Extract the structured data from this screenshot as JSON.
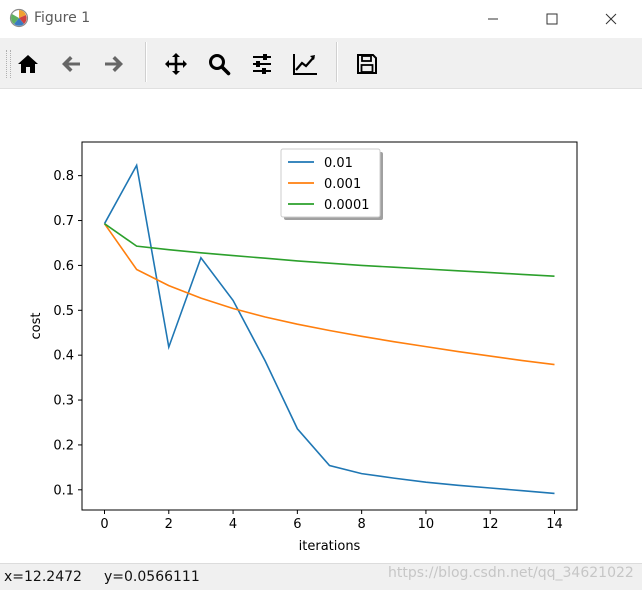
{
  "window": {
    "title": "Figure 1",
    "controls": {
      "minimize": "—",
      "maximize": "☐",
      "close": "✕"
    }
  },
  "toolbar": {
    "buttons": [
      {
        "icon": "home-icon"
      },
      {
        "icon": "back-arrow-icon"
      },
      {
        "icon": "forward-arrow-icon"
      },
      {
        "icon": "pan-icon"
      },
      {
        "icon": "zoom-icon"
      },
      {
        "icon": "configure-subplots-icon"
      },
      {
        "icon": "edit-axis-icon"
      },
      {
        "icon": "save-icon"
      }
    ]
  },
  "status": {
    "x": "x=12.2472",
    "y": "y=0.0566111",
    "watermark": "https://blog.csdn.net/qq_34621022"
  },
  "chart_data": {
    "type": "line",
    "xlabel": "iterations",
    "ylabel": "cost",
    "xlim": [
      -0.7,
      14.7
    ],
    "ylim": [
      0.055,
      0.875
    ],
    "xticks": [
      "0",
      "2",
      "4",
      "6",
      "8",
      "10",
      "12",
      "14"
    ],
    "yticks": [
      "0.1",
      "0.2",
      "0.3",
      "0.4",
      "0.5",
      "0.6",
      "0.7",
      "0.8"
    ],
    "legend_position": "top-center",
    "grid": false,
    "x": [
      0,
      1,
      2,
      3,
      4,
      5,
      6,
      7,
      8,
      9,
      10,
      11,
      12,
      13,
      14
    ],
    "series": [
      {
        "name": "0.01",
        "color": "#1f77b4",
        "values": [
          0.693,
          0.823,
          0.418,
          0.617,
          0.522,
          0.387,
          0.236,
          0.154,
          0.136,
          0.126,
          0.117,
          0.11,
          0.104,
          0.098,
          0.092
        ]
      },
      {
        "name": "0.001",
        "color": "#ff7f0e",
        "values": [
          0.693,
          0.591,
          0.555,
          0.527,
          0.504,
          0.485,
          0.469,
          0.455,
          0.442,
          0.43,
          0.419,
          0.408,
          0.398,
          0.388,
          0.379
        ]
      },
      {
        "name": "0.0001",
        "color": "#2ca02c",
        "values": [
          0.693,
          0.643,
          0.635,
          0.628,
          0.622,
          0.616,
          0.61,
          0.605,
          0.6,
          0.596,
          0.592,
          0.588,
          0.584,
          0.58,
          0.576
        ]
      }
    ]
  }
}
